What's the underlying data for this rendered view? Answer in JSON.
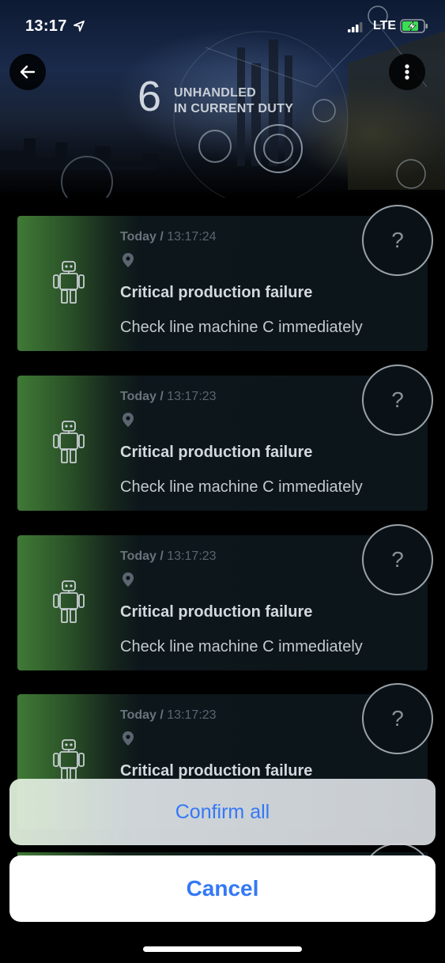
{
  "status_bar": {
    "time": "13:17",
    "network": "LTE",
    "icons": [
      "location-arrow-icon",
      "signal-icon",
      "battery-charging-icon"
    ]
  },
  "header": {
    "back_icon": "back-arrow-icon",
    "more_icon": "more-vertical-icon",
    "unhandled_count": "6",
    "unhandled_label_line1": "UNHANDLED",
    "unhandled_label_line2": "IN CURRENT DUTY"
  },
  "alerts": [
    {
      "day": "Today",
      "separator": " / ",
      "time": "13:17:24",
      "title": "Critical production failure",
      "description": "Check line machine C immediately",
      "icon": "robot-icon",
      "help_label": "?"
    },
    {
      "day": "Today",
      "separator": " / ",
      "time": "13:17:23",
      "title": "Critical production failure",
      "description": "Check line machine C immediately",
      "icon": "robot-icon",
      "help_label": "?"
    },
    {
      "day": "Today",
      "separator": " / ",
      "time": "13:17:23",
      "title": "Critical production failure",
      "description": "Check line machine C immediately",
      "icon": "robot-icon",
      "help_label": "?"
    },
    {
      "day": "Today",
      "separator": " / ",
      "time": "13:17:23",
      "title": "Critical production failure",
      "description": "",
      "icon": "robot-icon",
      "help_label": "?"
    }
  ],
  "action_sheet": {
    "confirm_all_label": "Confirm all",
    "cancel_label": "Cancel"
  },
  "colors": {
    "accent_blue": "#3478f6",
    "card_green": "#3f7a35",
    "card_dark": "#0b151a"
  }
}
